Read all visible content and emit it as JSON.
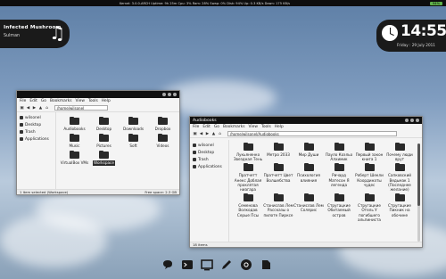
{
  "topbar": {
    "stats": "Kernel: 3.0.0-ARCH  Uptime: 9h 25m  Cpu: 3%  Ram: 28%  Swap: 0%  Disk: 94%  Up: 0.3 KB/s  Down: 175 KB/s",
    "battery": "94%"
  },
  "music": {
    "title": "Infected Mushroom",
    "artist": "Sulman",
    "icon": "music-note-icon"
  },
  "clock": {
    "time": "14:55",
    "date": "Friday : 29 July 2011"
  },
  "window_home": {
    "title": "",
    "menu": [
      "File",
      "Edit",
      "Go",
      "Bookmarks",
      "View",
      "Tools",
      "Help"
    ],
    "path": "/home/wilsonel",
    "sidebar": [
      {
        "label": "wilsonel",
        "icon": "home-icon"
      },
      {
        "label": "Desktop",
        "icon": "desktop-icon"
      },
      {
        "label": "Trash",
        "icon": "trash-icon"
      },
      {
        "label": "Applications",
        "icon": "applications-icon"
      }
    ],
    "folders": [
      "Audiobooks",
      "Desktop",
      "Downloads",
      "Dropbox",
      "Music",
      "Pictures",
      "Soft",
      "Videos",
      "VirtualBox VMs",
      "Workspace"
    ],
    "status_left": "1 item selected (Workspace)",
    "status_right": "Free space: 2.3 GB"
  },
  "window_audio": {
    "title": "Audiobooks",
    "menu": [
      "File",
      "Edit",
      "Go",
      "Bookmarks",
      "View",
      "Tools",
      "Help"
    ],
    "path": "/home/wilsonel/Audiobooks",
    "sidebar": [
      {
        "label": "wilsonel",
        "icon": "home-icon"
      },
      {
        "label": "Desktop",
        "icon": "desktop-icon"
      },
      {
        "label": "Trash",
        "icon": "trash-icon"
      },
      {
        "label": "Applications",
        "icon": "applications-icon"
      }
    ],
    "folders": [
      "Лукьяненко Звездная Тень",
      "Метро 2033",
      "Мир Души",
      "Пауло Коэльо Алхимик",
      "Первый закон книга 1",
      "Почему люди врут",
      "Пратчетт Анекс Доблая проклятая ниагара",
      "Пратчетт Цвет Волшебства",
      "Психология влияния",
      "Ричард Матесон Я легенда",
      "Роберт Шекли Координаты чудес",
      "Сапковский Ведьмак 1 (Последнее желание)",
      "Семенова Волкодав Серые Псы",
      "Станислав Лем Рассказы о пилоте Пирксе",
      "Станислав Лем Солярис",
      "Стругацкие Обитаемый остров",
      "Стругацкие Отель У погибшего альпиниста",
      "Стругацкие Пикник на обочине"
    ],
    "status_left": "18 items",
    "status_right": ""
  },
  "dock": [
    {
      "name": "pidgin-icon"
    },
    {
      "name": "terminal-icon"
    },
    {
      "name": "window-icon"
    },
    {
      "name": "editor-icon"
    },
    {
      "name": "chrome-icon"
    },
    {
      "name": "files-icon"
    }
  ]
}
